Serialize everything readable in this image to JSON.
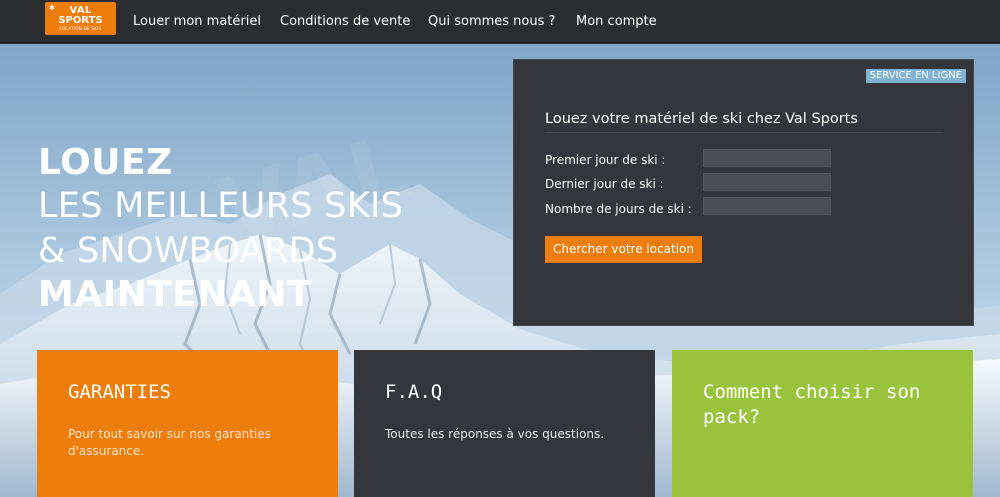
{
  "brand": {
    "logo_line1": "VAL",
    "logo_line2": "SPORTS",
    "logo_line3": "LOCATION DE SKIS",
    "accent": "#ef7d0b"
  },
  "nav": {
    "items": [
      {
        "label": "Louer mon matériel"
      },
      {
        "label": "Conditions de vente"
      },
      {
        "label": "Qui sommes nous ?"
      },
      {
        "label": "Mon compte"
      }
    ]
  },
  "hero": {
    "line1": "LOUEZ",
    "line2": "LES MEILLEURS SKIS",
    "line3": "& SNOWBOARDS",
    "line4": "MAINTENANT"
  },
  "booking": {
    "badge": "SERVICE EN LIGNE",
    "badge_color": "#7fb2d3",
    "title": "Louez votre matériel de ski chez Val Sports",
    "fields": [
      {
        "label": "Premier jour de ski :",
        "value": ""
      },
      {
        "label": "Dernier jour de ski :",
        "value": ""
      },
      {
        "label": "Nombre de jours de ski :",
        "value": ""
      }
    ],
    "submit_label": "Chercher votre location"
  },
  "cards": [
    {
      "title": "GARANTIES",
      "text": "Pour tout savoir sur nos garanties d'assurance.",
      "bg": "#ef7d0b"
    },
    {
      "title": "F.A.Q",
      "text": "Toutes les réponses à vos questions.",
      "bg": "#35363b"
    },
    {
      "title": "Comment choisir son pack?",
      "text": "",
      "bg": "#99c33d"
    }
  ]
}
